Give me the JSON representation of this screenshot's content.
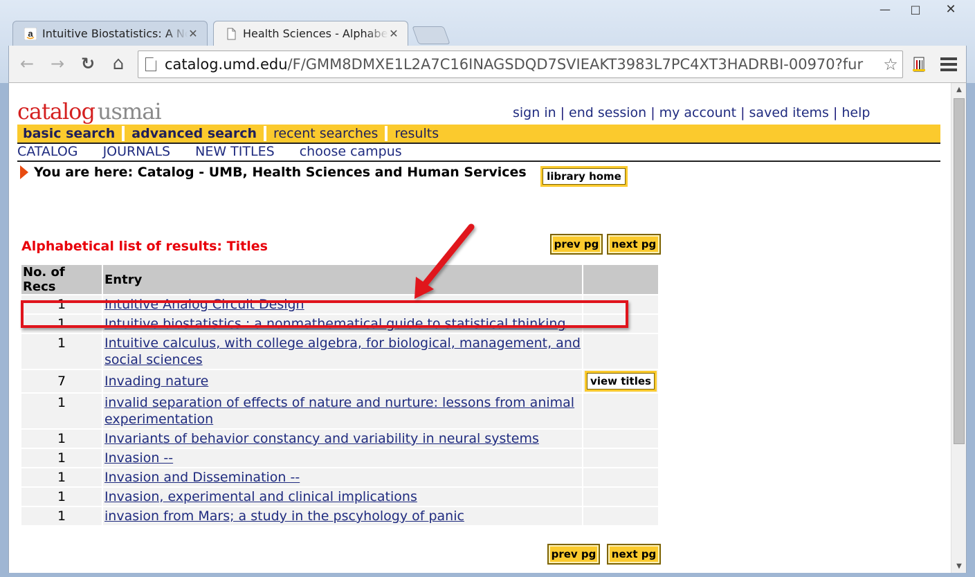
{
  "browser": {
    "window_controls": {
      "minimize": "—",
      "maximize": "□",
      "close": "✕"
    },
    "tabs": [
      {
        "title": "Intuitive Biostatistics: A No",
        "favicon": "amazon-icon",
        "active": false
      },
      {
        "title": "Health Sciences - Alphabe",
        "favicon": "page-icon",
        "active": true
      }
    ],
    "url_host": "catalog.umd.edu",
    "url_path": "/F/GMM8DMXE1L2A7C16INAGSDQD7SVIEAKT3983L7PC4XT3HADRBI-00970?fur",
    "nav_icons": {
      "back": "←",
      "forward": "→",
      "reload": "↻",
      "home": "⌂",
      "star": "☆"
    }
  },
  "site": {
    "logo_part1": "catalog",
    "logo_part2": "usmai",
    "top_links": [
      "sign in",
      "end session",
      "my account",
      "saved items",
      "help"
    ],
    "main_nav": [
      {
        "label": "basic search",
        "bold": true
      },
      {
        "label": "advanced search",
        "bold": true
      },
      {
        "label": "recent searches",
        "bold": false
      },
      {
        "label": "results",
        "bold": false
      }
    ],
    "sub_nav": [
      "CATALOG",
      "JOURNALS",
      "NEW TITLES",
      "choose campus"
    ],
    "breadcrumb": "You are here: Catalog - UMB, Health Sciences and Human Services",
    "library_home": "library home"
  },
  "results": {
    "title": "Alphabetical list of results: Titles",
    "prev_label": "prev pg",
    "next_label": "next pg",
    "headers": [
      "No. of Recs",
      "Entry",
      ""
    ],
    "rows": [
      {
        "count": "1",
        "entry": "Intuitive Analog Circuit Design",
        "action": ""
      },
      {
        "count": "1",
        "entry": "Intuitive biostatistics : a nonmathematical guide to statistical thinking",
        "action": ""
      },
      {
        "count": "1",
        "entry": "Intuitive calculus, with college algebra, for biological, management, and social sciences",
        "action": ""
      },
      {
        "count": "7",
        "entry": "Invading nature",
        "action": "view titles"
      },
      {
        "count": "1",
        "entry": "invalid separation of effects of nature and nurture: lessons from animal experimentation",
        "action": ""
      },
      {
        "count": "1",
        "entry": "Invariants of behavior constancy and variability in neural systems",
        "action": ""
      },
      {
        "count": "1",
        "entry": "Invasion --",
        "action": ""
      },
      {
        "count": "1",
        "entry": "Invasion and Dissemination --",
        "action": ""
      },
      {
        "count": "1",
        "entry": "Invasion, experimental and clinical implications",
        "action": ""
      },
      {
        "count": "1",
        "entry": "invasion from Mars; a study in the pscyhology of panic",
        "action": ""
      }
    ]
  },
  "colors": {
    "accent_yellow": "#fbca2d",
    "logo_red": "#d41f1f",
    "annotation_red": "#e0141c",
    "link_blue": "#1f2b7f"
  }
}
